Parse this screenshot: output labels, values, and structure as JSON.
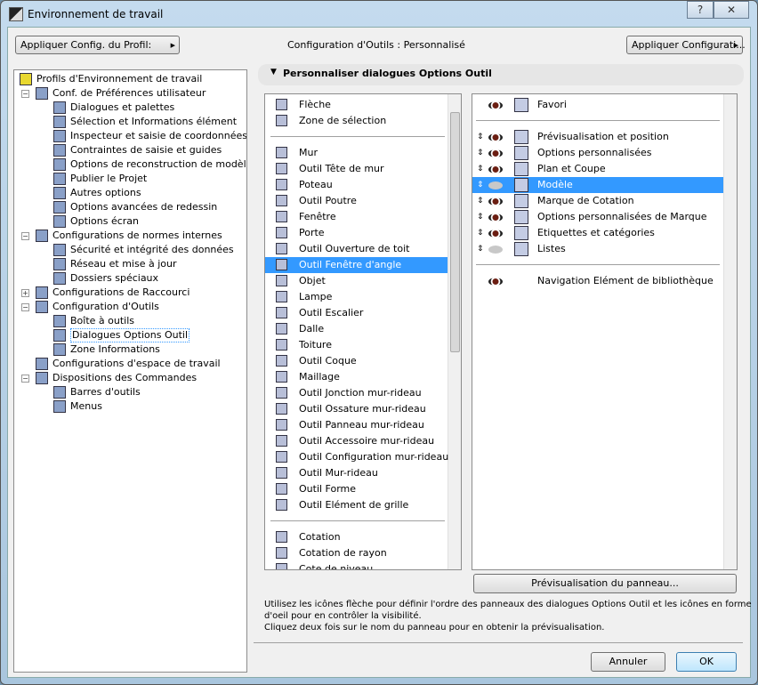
{
  "window": {
    "title": "Environnement de travail",
    "help": "?",
    "close": "✕"
  },
  "toolbar": {
    "apply_profile": "Appliquer Config. du Profil:",
    "status": "Configuration d'Outils : Personnalisé",
    "apply_config": "Appliquer Configurati..."
  },
  "tree": [
    {
      "label": "Profils d'Environnement de travail",
      "level": 0
    },
    {
      "label": "Conf. de Préférences utilisateur",
      "level": 1,
      "expander": "−"
    },
    {
      "label": "Dialogues et palettes",
      "level": 2
    },
    {
      "label": "Sélection et Informations élément",
      "level": 2
    },
    {
      "label": "Inspecteur et saisie de coordonnées",
      "level": 2
    },
    {
      "label": "Contraintes de saisie et guides",
      "level": 2
    },
    {
      "label": "Options de reconstruction de modèle",
      "level": 2
    },
    {
      "label": "Publier le Projet",
      "level": 2
    },
    {
      "label": "Autres options",
      "level": 2
    },
    {
      "label": "Options avancées de redessin",
      "level": 2
    },
    {
      "label": "Options écran",
      "level": 2
    },
    {
      "label": "Configurations de normes internes",
      "level": 1,
      "expander": "−"
    },
    {
      "label": "Sécurité et intégrité des données",
      "level": 2
    },
    {
      "label": "Réseau et mise à jour",
      "level": 2
    },
    {
      "label": "Dossiers spéciaux",
      "level": 2
    },
    {
      "label": "Configurations de Raccourci",
      "level": 1,
      "expander": "+"
    },
    {
      "label": "Configuration d'Outils",
      "level": 1,
      "expander": "−"
    },
    {
      "label": "Boîte à outils",
      "level": 2
    },
    {
      "label": "Dialogues Options Outil",
      "level": 2,
      "focused": true
    },
    {
      "label": "Zone Informations",
      "level": 2
    },
    {
      "label": "Configurations d'espace de travail",
      "level": 1
    },
    {
      "label": "Dispositions des Commandes",
      "level": 1,
      "expander": "−"
    },
    {
      "label": "Barres d'outils",
      "level": 2
    },
    {
      "label": "Menus",
      "level": 2
    }
  ],
  "section": {
    "title": "Personnaliser dialogues Options Outil",
    "toggle": "▼"
  },
  "tools": [
    {
      "label": "Flèche",
      "icon": "arrow-icon"
    },
    {
      "label": "Zone de sélection",
      "icon": "marquee-icon"
    },
    {
      "sep": true
    },
    {
      "label": "Mur"
    },
    {
      "label": "Outil Tête de mur"
    },
    {
      "label": "Poteau"
    },
    {
      "label": "Outil Poutre"
    },
    {
      "label": "Fenêtre"
    },
    {
      "label": "Porte"
    },
    {
      "label": "Outil Ouverture de toit"
    },
    {
      "label": "Outil Fenêtre d'angle",
      "selected": true
    },
    {
      "label": "Objet"
    },
    {
      "label": "Lampe"
    },
    {
      "label": "Outil Escalier"
    },
    {
      "label": "Dalle"
    },
    {
      "label": "Toiture"
    },
    {
      "label": "Outil Coque"
    },
    {
      "label": "Maillage"
    },
    {
      "label": "Outil Jonction mur-rideau"
    },
    {
      "label": "Outil Ossature mur-rideau"
    },
    {
      "label": "Outil Panneau mur-rideau"
    },
    {
      "label": "Outil Accessoire mur-rideau"
    },
    {
      "label": "Outil Configuration mur-rideau"
    },
    {
      "label": "Outil Mur-rideau"
    },
    {
      "label": "Outil Forme"
    },
    {
      "label": "Outil Elément de grille"
    },
    {
      "sep": true
    },
    {
      "label": "Cotation"
    },
    {
      "label": "Cotation de rayon"
    },
    {
      "label": "Cote de niveau"
    }
  ],
  "panels": [
    {
      "label": "Favori",
      "visible": true,
      "movable": false
    },
    {
      "sep": true
    },
    {
      "label": "Prévisualisation et position",
      "visible": true,
      "movable": true
    },
    {
      "label": "Options personnalisées",
      "visible": true,
      "movable": true
    },
    {
      "label": "Plan et Coupe",
      "visible": true,
      "movable": true
    },
    {
      "label": "Modèle",
      "visible": false,
      "movable": true,
      "selected": true
    },
    {
      "label": "Marque de Cotation",
      "visible": true,
      "movable": true
    },
    {
      "label": "Options personnalisées de Marque",
      "visible": true,
      "movable": true
    },
    {
      "label": "Etiquettes et catégories",
      "visible": true,
      "movable": true
    },
    {
      "label": "Listes",
      "visible": false,
      "movable": true
    },
    {
      "sep": true
    },
    {
      "label": "Navigation Elément de bibliothèque",
      "visible": true,
      "movable": false,
      "noicon": true
    }
  ],
  "preview_button": "Prévisualisation du panneau...",
  "help": {
    "line1": "Utilisez les icônes flèche pour définir l'ordre des panneaux des dialogues Options Outil et les icônes en forme",
    "line2": "d'oeil pour en contrôler la visibilité.",
    "line3": "Cliquez deux fois sur le nom du panneau pour en obtenir la prévisualisation."
  },
  "buttons": {
    "cancel": "Annuler",
    "ok": "OK"
  },
  "colors": {
    "selection": "#3399ff",
    "eye": "#6b1e12"
  }
}
